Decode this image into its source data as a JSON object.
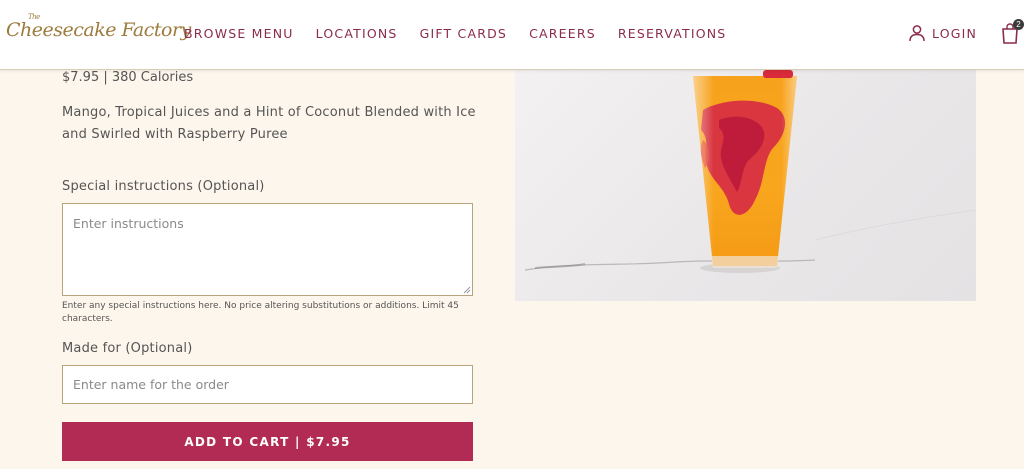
{
  "header": {
    "logo_small": "The",
    "logo_text": "Cheesecake Factory",
    "nav": [
      "BROWSE MENU",
      "LOCATIONS",
      "GIFT CARDS",
      "CAREERS",
      "RESERVATIONS"
    ],
    "login_label": "LOGIN",
    "cart_count": "2"
  },
  "product": {
    "price_calories": "$7.95 | 380 Calories",
    "description": "Mango, Tropical Juices and a Hint of Coconut Blended with Ice and Swirled with Raspberry Puree",
    "image_icon": "drink-image"
  },
  "form": {
    "special_label": "Special instructions (Optional)",
    "special_placeholder": "Enter instructions",
    "special_hint": "Enter any special instructions here. No price altering substitutions or additions. Limit 45 characters.",
    "made_for_label": "Made for (Optional)",
    "made_for_placeholder": "Enter name for the order",
    "add_to_cart_label": "ADD TO CART | $7.95"
  },
  "colors": {
    "accent": "#8b2c4d",
    "button": "#b12b54",
    "background": "#fdf6ec",
    "logo": "#9c7b3c"
  }
}
